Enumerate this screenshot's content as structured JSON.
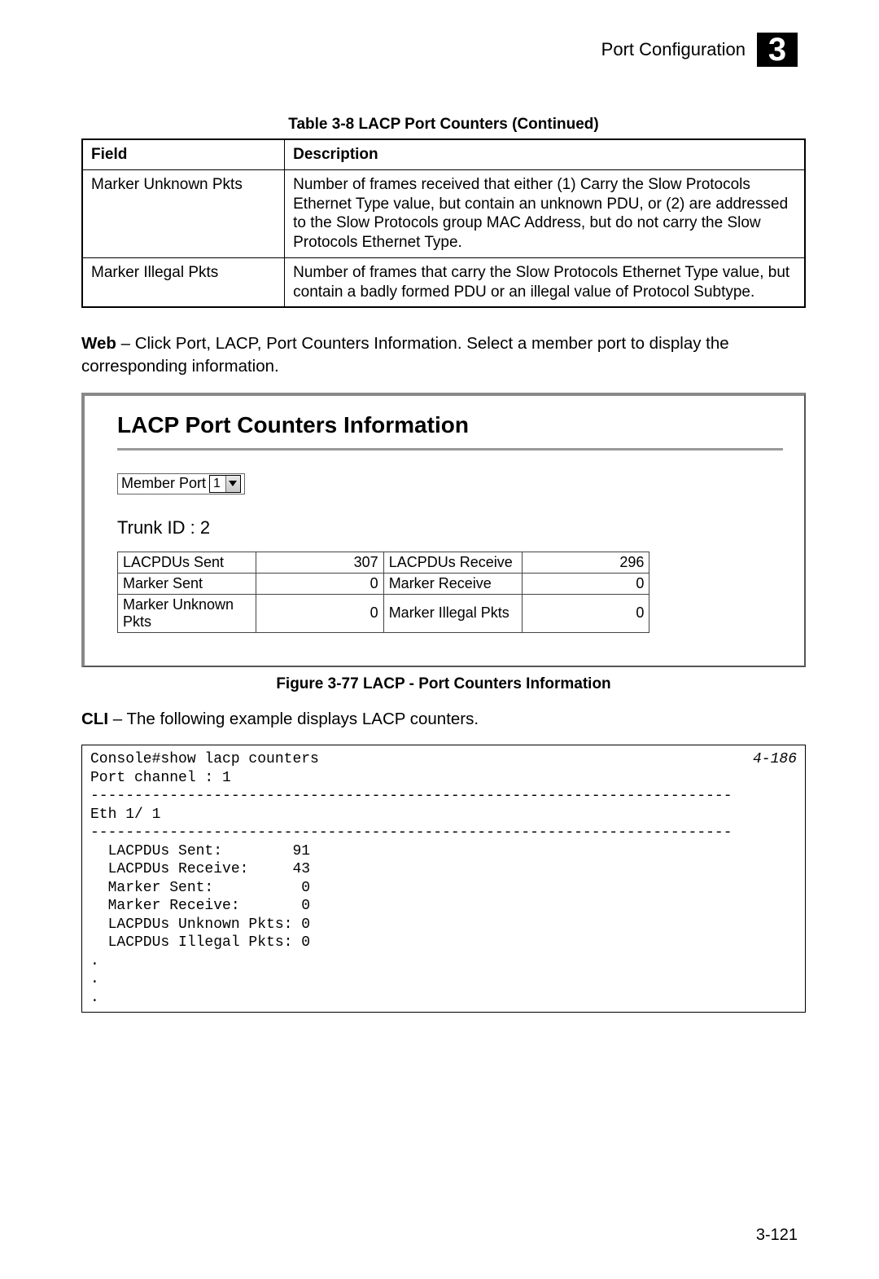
{
  "header": {
    "title": "Port Configuration",
    "chapter": "3"
  },
  "table_caption": "Table 3-8  LACP Port Counters  (Continued)",
  "table_headers": {
    "field": "Field",
    "desc": "Description"
  },
  "table_rows": [
    {
      "field": "Marker Unknown Pkts",
      "desc": "Number of frames received that either (1) Carry the Slow Protocols Ethernet Type value, but contain an unknown PDU, or (2) are addressed to the Slow Protocols group MAC Address, but do not carry the Slow Protocols Ethernet Type."
    },
    {
      "field": "Marker Illegal Pkts",
      "desc": "Number of frames that carry the Slow Protocols Ethernet Type value, but contain a badly formed PDU or an illegal value of Protocol Subtype."
    }
  ],
  "web_para_bold": "Web",
  "web_para": " – Click Port, LACP, Port Counters Information. Select a member port to display the corresponding information.",
  "screenshot": {
    "title": "LACP Port Counters Information",
    "member_port_label": "Member Port",
    "member_port_value": "1",
    "trunk_label": "Trunk ID : 2",
    "rows": [
      {
        "l1": "LACPDUs Sent",
        "v1": "307",
        "l2": "LACPDUs Receive",
        "v2": "296"
      },
      {
        "l1": "Marker Sent",
        "v1": "0",
        "l2": "Marker Receive",
        "v2": "0"
      },
      {
        "l1": "Marker Unknown Pkts",
        "v1": "0",
        "l2": "Marker Illegal Pkts",
        "v2": "0"
      }
    ]
  },
  "figure_caption": "Figure 3-77  LACP - Port Counters Information",
  "cli_para_bold": "CLI",
  "cli_para": " – The following example displays LACP counters.",
  "cli": {
    "ref": "4-186",
    "text": "Console#show lacp counters\nPort channel : 1\n-------------------------------------------------------------------------\nEth 1/ 1 \n-------------------------------------------------------------------------\n  LACPDUs Sent:        91\n  LACPDUs Receive:     43\n  Marker Sent:          0\n  Marker Receive:       0\n  LACPDUs Unknown Pkts: 0\n  LACPDUs Illegal Pkts: 0\n.\n.\n."
  },
  "page_number": "3-121"
}
